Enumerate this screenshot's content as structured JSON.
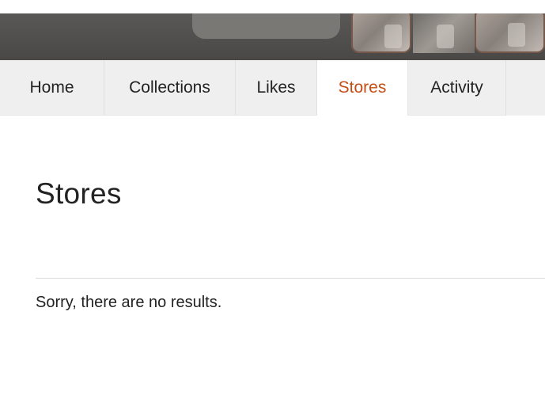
{
  "nav": {
    "tabs": [
      {
        "label": "Home",
        "active": false
      },
      {
        "label": "Collections",
        "active": false
      },
      {
        "label": "Likes",
        "active": false
      },
      {
        "label": "Stores",
        "active": true
      },
      {
        "label": "Activity",
        "active": false
      }
    ]
  },
  "main": {
    "title": "Stores",
    "empty_message": "Sorry, there are no results."
  },
  "colors": {
    "accent": "#c64d15",
    "tabbar_bg": "#efefef",
    "banner_bg": "#4f4d4b"
  }
}
